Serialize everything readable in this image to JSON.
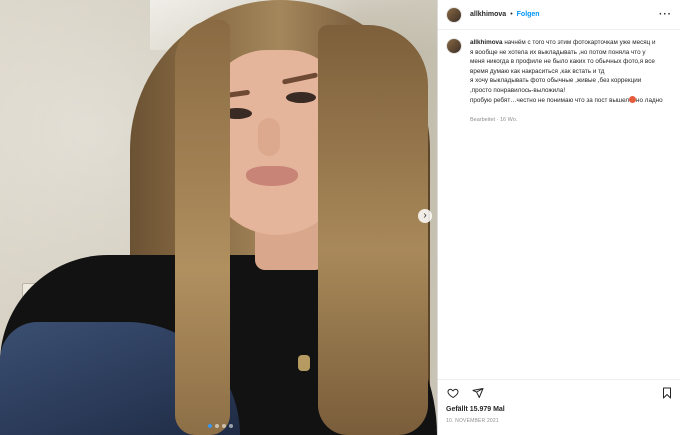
{
  "header": {
    "username": "allkhimova",
    "separator": "•",
    "follow_label": "Folgen",
    "more_icon": "more-horizontal-icon"
  },
  "caption": {
    "username": "allkhimova",
    "lines": [
      "начнём с того что этим фотокарточкам уже месяц и",
      "я вообще не хотела их выкладывать ,но потом поняла что у",
      "меня никогда в профиле не было каких то обычных фото,я все",
      "время думаю как накраситься ,как встать и тд",
      "я хочу выкладывать фото обычные ,живые ,без коррекции",
      ",просто понравилось-выложила!",
      "пробую ребят…честно не понимаю что за пост вышел",
      "но ладно"
    ],
    "edited": "Bearbeitet · 16 Wo."
  },
  "media": {
    "next_icon": "chevron-right-icon",
    "carousel_count": 4,
    "carousel_active": 1
  },
  "footer": {
    "likes": "Gefällt 15.979 Mal",
    "date": "10. NOVEMBER 2021"
  },
  "colors": {
    "link": "#0095f6",
    "text": "#262626",
    "muted": "#8e8e8e",
    "carousel_active": "#3897f0"
  }
}
